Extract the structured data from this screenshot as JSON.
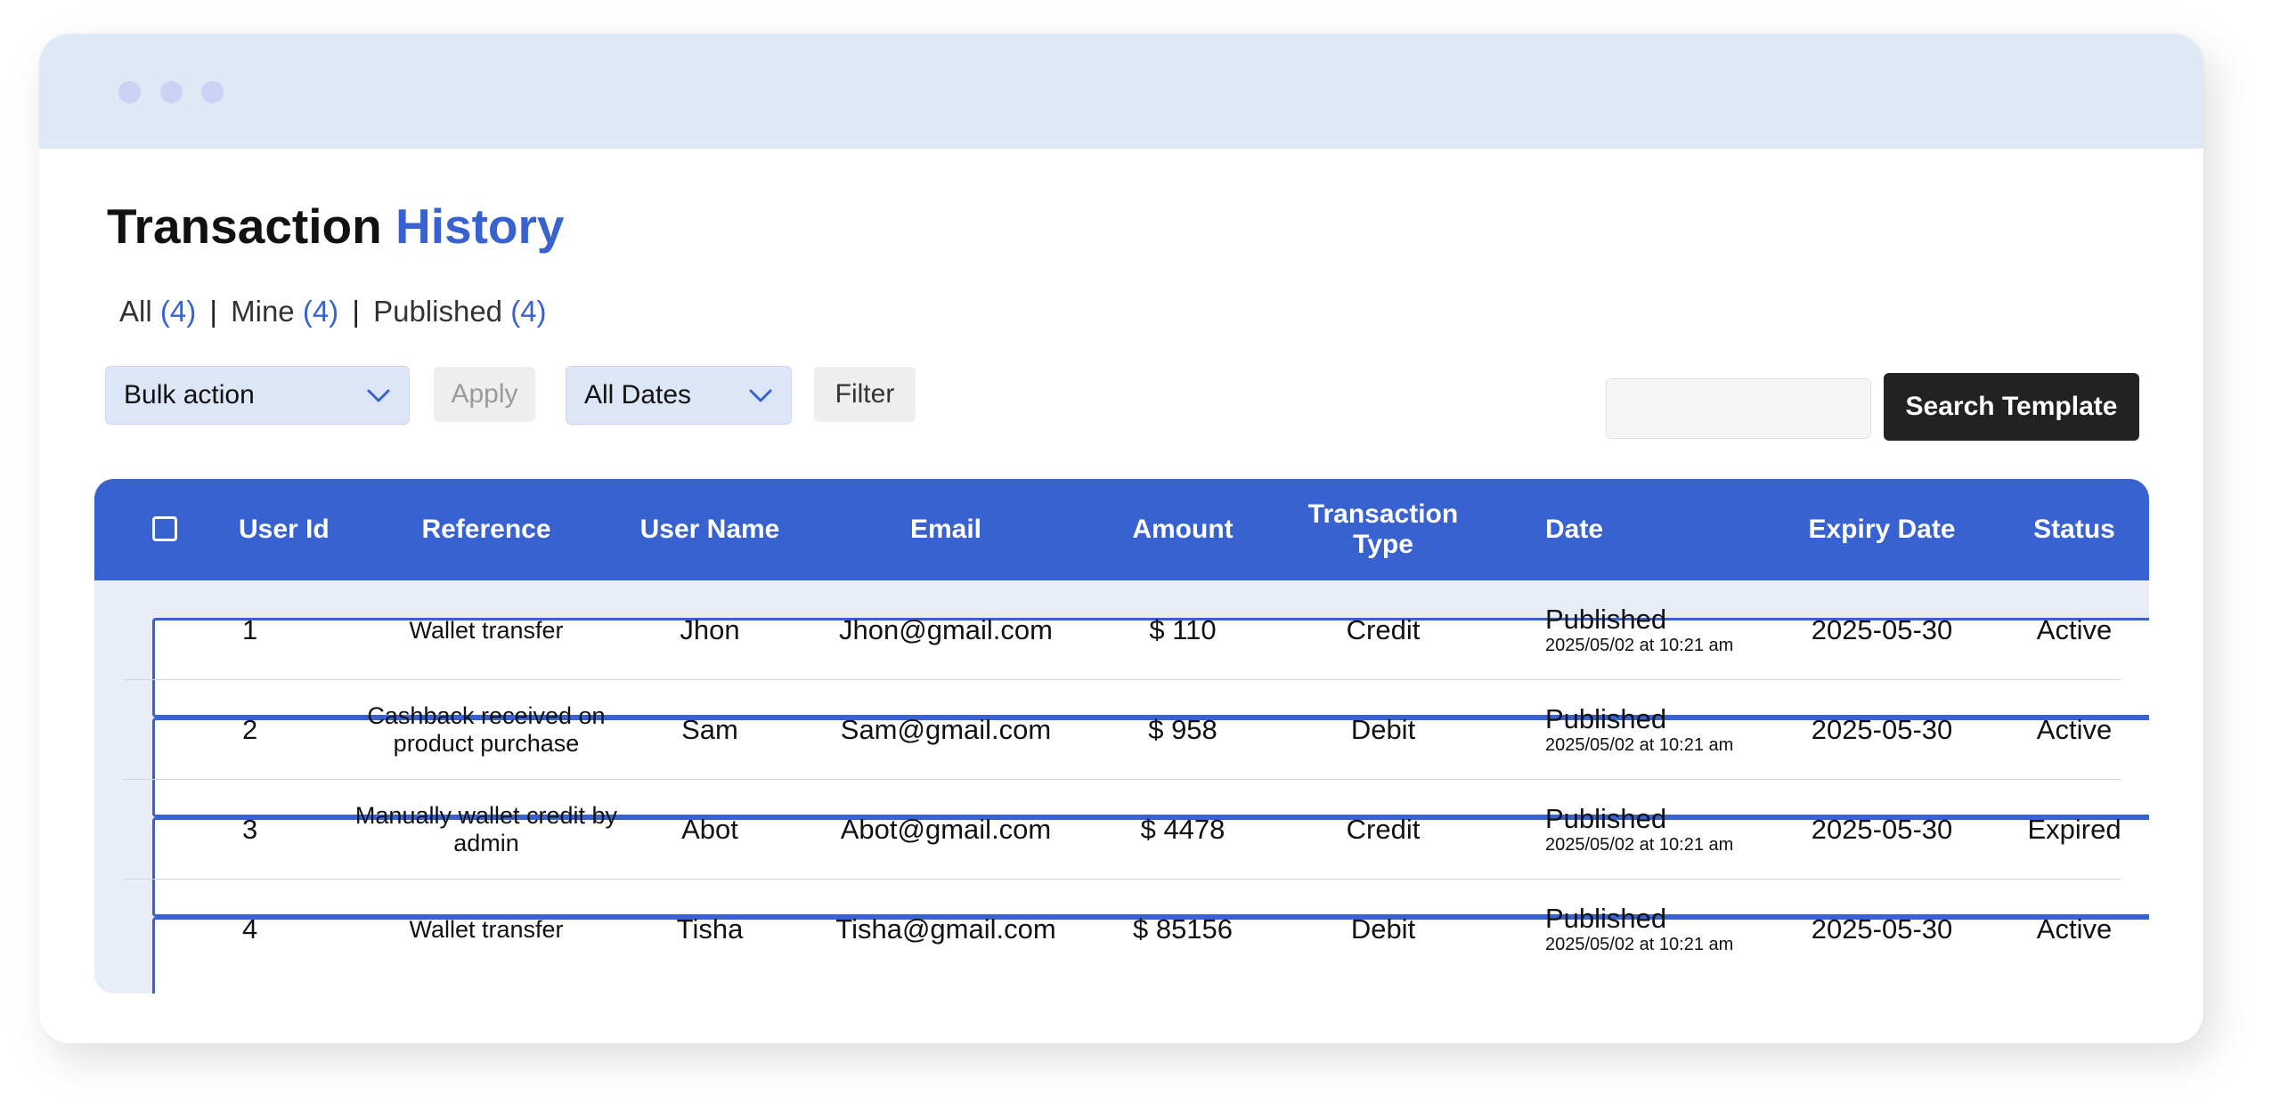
{
  "header": {
    "title_main": "Transaction",
    "title_accent": "History"
  },
  "filters": {
    "all_label": "All",
    "all_count": "(4)",
    "mine_label": "Mine",
    "mine_count": "(4)",
    "published_label": "Published",
    "published_count": "(4)",
    "separator": "|"
  },
  "toolbar": {
    "bulk_action": "Bulk action",
    "apply_label": "Apply",
    "dates_select": "All Dates",
    "filter_label": "Filter",
    "search_value": "",
    "search_button": "Search Template"
  },
  "colors": {
    "accent": "#3762d0",
    "titlebar": "#dfe8f5",
    "table_body": "#e9edf8",
    "search_button": "#222222"
  },
  "table": {
    "headers": {
      "user_id": "User Id",
      "reference": "Reference",
      "user_name": "User Name",
      "email": "Email",
      "amount": "Amount",
      "transaction_type": "Transaction Type",
      "date": "Date",
      "expiry_date": "Expiry Date",
      "status": "Status"
    },
    "rows": [
      {
        "user_id": "1",
        "reference": "Wallet transfer",
        "user_name": "Jhon",
        "email": "Jhon@gmail.com",
        "amount": "$ 110",
        "transaction_type": "Credit",
        "date_status": "Published",
        "date_time": "2025/05/02 at 10:21 am",
        "expiry_date": "2025-05-30",
        "status": "Active"
      },
      {
        "user_id": "2",
        "reference": "Cashback received on product purchase",
        "user_name": "Sam",
        "email": "Sam@gmail.com",
        "amount": "$ 958",
        "transaction_type": "Debit",
        "date_status": "Published",
        "date_time": "2025/05/02 at 10:21 am",
        "expiry_date": "2025-05-30",
        "status": "Active"
      },
      {
        "user_id": "3",
        "reference": "Manually wallet credit by admin",
        "user_name": "Abot",
        "email": "Abot@gmail.com",
        "amount": "$ 4478",
        "transaction_type": "Credit",
        "date_status": "Published",
        "date_time": "2025/05/02 at 10:21 am",
        "expiry_date": "2025-05-30",
        "status": "Expired"
      },
      {
        "user_id": "4",
        "reference": "Wallet transfer",
        "user_name": "Tisha",
        "email": "Tisha@gmail.com",
        "amount": "$ 85156",
        "transaction_type": "Debit",
        "date_status": "Published",
        "date_time": "2025/05/02 at 10:21 am",
        "expiry_date": "2025-05-30",
        "status": "Active"
      }
    ]
  }
}
